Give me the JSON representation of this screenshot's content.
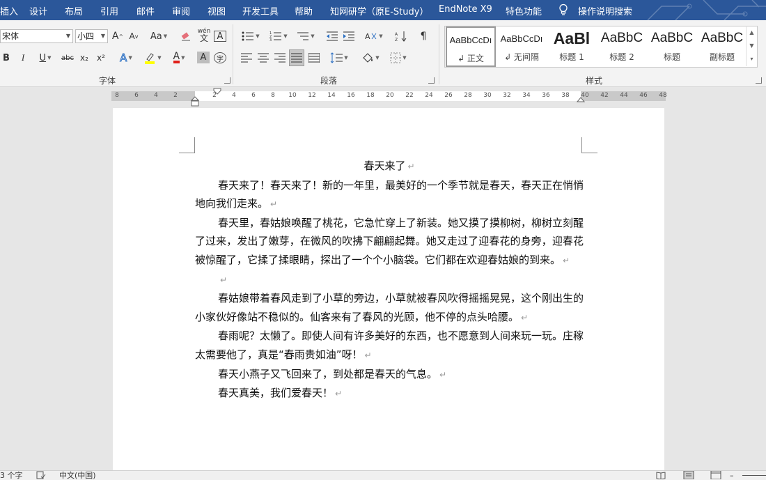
{
  "menu": {
    "tabs": [
      "插入",
      "设计",
      "布局",
      "引用",
      "邮件",
      "审阅",
      "视图",
      "开发工具",
      "帮助",
      "知网研学（原E-Study）",
      "EndNote X9",
      "特色功能",
      "操作说明搜索"
    ]
  },
  "ribbon": {
    "font": {
      "name_value": "宋体",
      "size_value": "小四",
      "group_label": "字体",
      "bold": "B",
      "italic": "I",
      "underline": "U",
      "strike": "abc",
      "subscript": "x₂",
      "superscript": "x²",
      "change_case": "Aa",
      "grow": "A",
      "shrink": "A",
      "pinyin": "wén",
      "border": "A",
      "shading": "A",
      "enclose": "字"
    },
    "paragraph": {
      "group_label": "段落"
    },
    "styles": {
      "group_label": "样式",
      "items": [
        {
          "sample": "AaBbCcDı",
          "name": "↲ 正文"
        },
        {
          "sample": "AaBbCcDı",
          "name": "↲ 无间隔"
        },
        {
          "sample": "AaBl",
          "name": "标题 1"
        },
        {
          "sample": "AaBbC",
          "name": "标题 2"
        },
        {
          "sample": "AaBbC",
          "name": "标题"
        },
        {
          "sample": "AaBbC",
          "name": "副标题"
        }
      ]
    }
  },
  "ruler": {
    "labels": [
      "8",
      "6",
      "4",
      "2",
      "2",
      "4",
      "6",
      "8",
      "10",
      "12",
      "14",
      "16",
      "18",
      "20",
      "22",
      "24",
      "26",
      "28",
      "30",
      "32",
      "34",
      "36",
      "38",
      "40",
      "42",
      "44",
      "46",
      "48"
    ]
  },
  "document": {
    "paragraph_mark": "↵",
    "paragraphs": [
      {
        "text": "春天来了",
        "type": "title"
      },
      {
        "text": "春天来了！春天来了！新的一年里，最美好的一个季节就是春天，春天正在悄悄地向我们走来。",
        "type": "body"
      },
      {
        "text": "春天里，春姑娘唤醒了桃花，它急忙穿上了新装。她又摸了摸柳树，柳树立刻醒了过来，发出了嫩芽，在微风的吹拂下翩翩起舞。她又走过了迎春花的身旁，迎春花被惊醒了，它揉了揉眼睛，探出了一个个小脑袋。它们都在欢迎春姑娘的到来。",
        "type": "body"
      },
      {
        "text": "",
        "type": "empty"
      },
      {
        "text": "春姑娘带着春风走到了小草的旁边，小草就被春风吹得摇摇晃晃，这个刚出生的小家伙好像站不稳似的。仙客来有了春风的光顾，他不停的点头哈腰。",
        "type": "body"
      },
      {
        "text": "春雨呢？太懒了。即使人间有许多美好的东西，也不愿意到人间来玩一玩。庄稼太需要他了，真是“春雨贵如油”呀！",
        "type": "body"
      },
      {
        "text": "春天小燕子又飞回来了，到处都是春天的气息。",
        "type": "body"
      },
      {
        "text": "春天真美，我们爱春天！",
        "type": "body"
      }
    ]
  },
  "statusbar": {
    "word_count": "3 个字",
    "language": "中文(中国)"
  },
  "colors": {
    "title_bar": "#2b579a",
    "ribbon_bg": "#f3f3f3",
    "page_bg": "#ffffff",
    "workspace_bg": "#e6e6e6"
  }
}
